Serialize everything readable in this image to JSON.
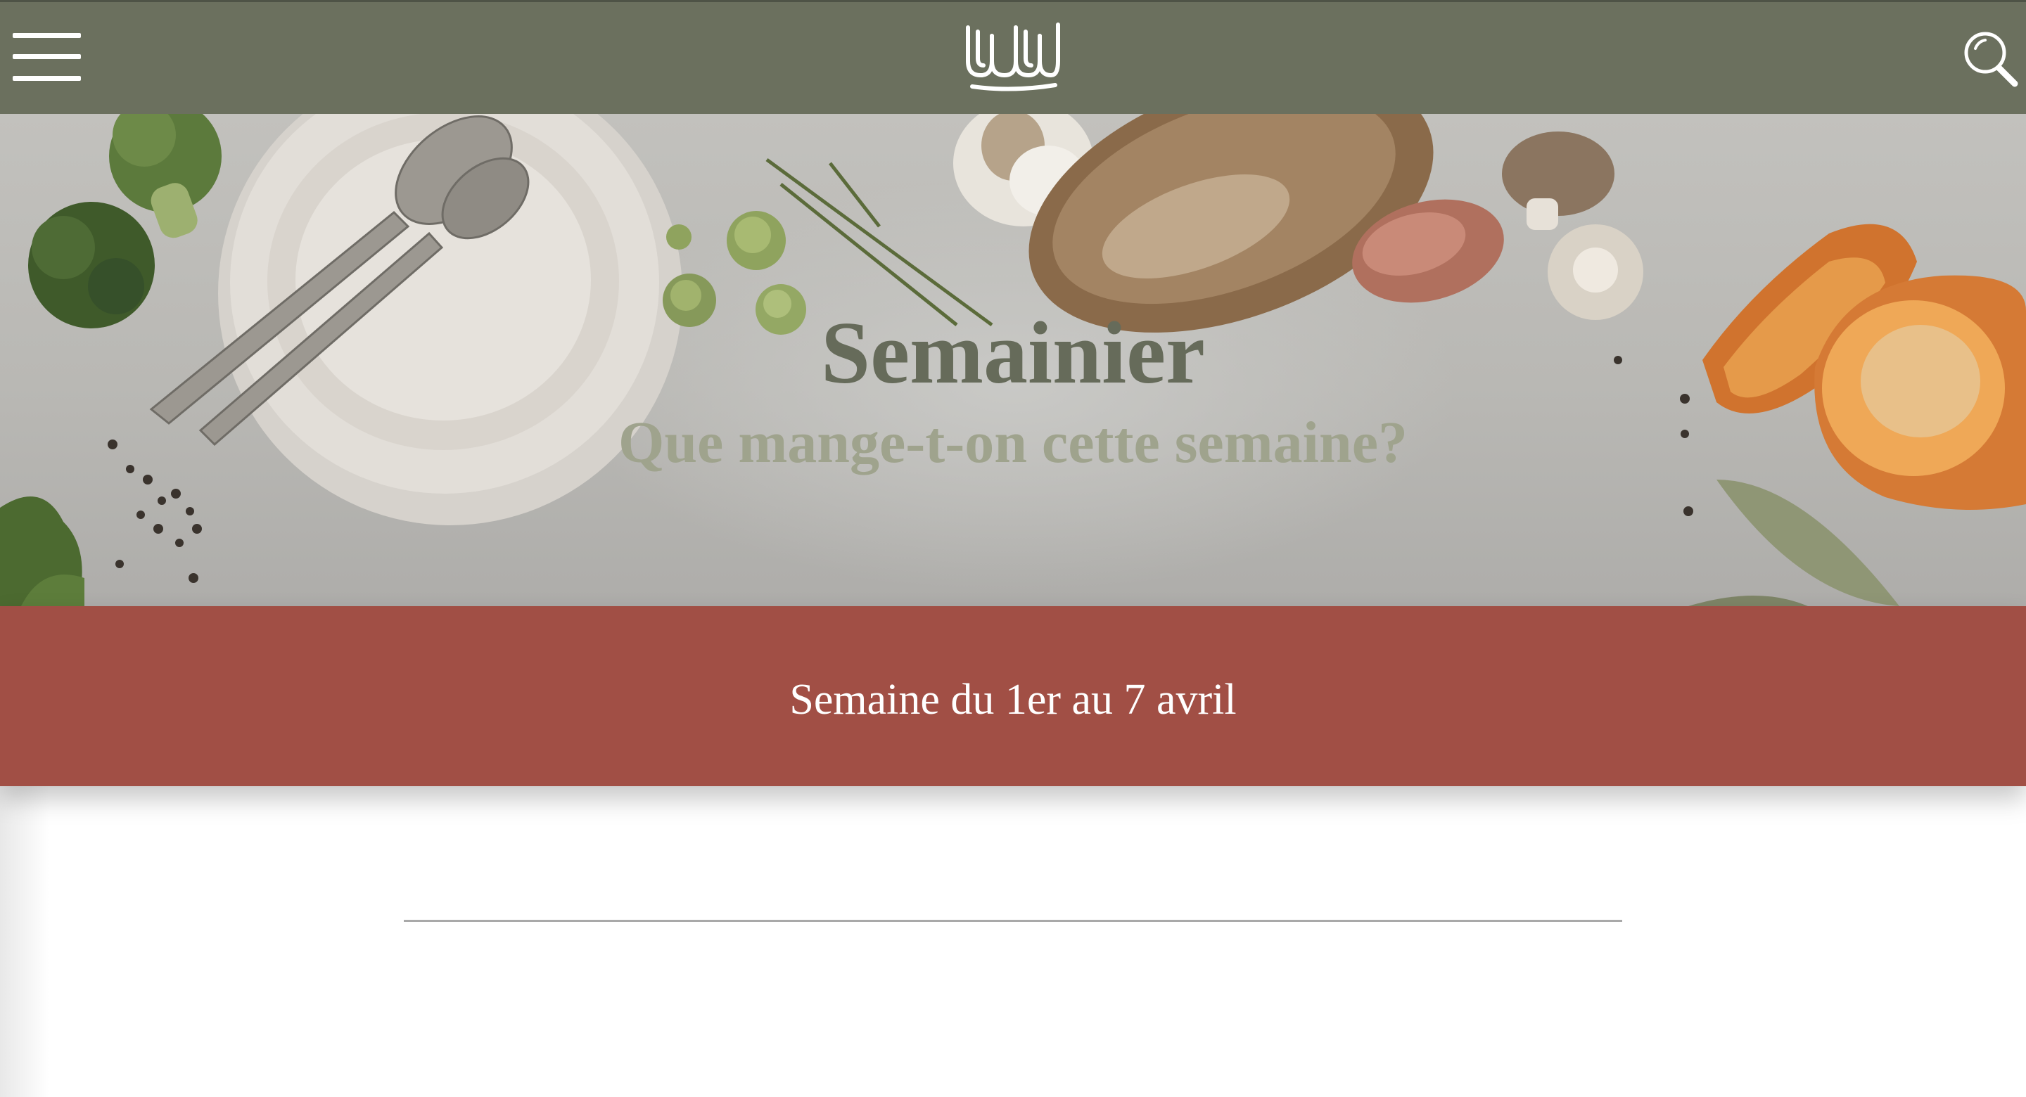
{
  "navbar": {
    "menu_icon": "hamburger-menu-icon",
    "logo_icon": "brand-logo-icon",
    "search_icon": "search-icon",
    "background_color": "#6b705e"
  },
  "hero": {
    "title": "Semainier",
    "subtitle": "Que mange-t-on cette semaine?",
    "title_color": "#666b5a",
    "subtitle_color": "#9fa38d"
  },
  "week_banner": {
    "text": "Semaine du 1er au 7 avril",
    "background_color": "#a14f45"
  }
}
